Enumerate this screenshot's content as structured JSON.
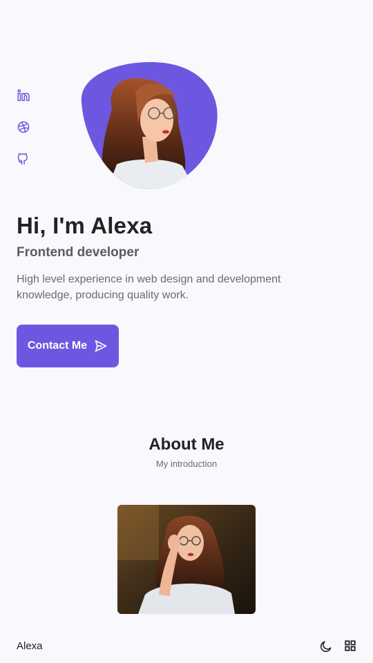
{
  "social": {
    "icons": [
      "linkedin-icon",
      "dribbble-icon",
      "github-icon"
    ]
  },
  "hero": {
    "title": "Hi, I'm Alexa",
    "subtitle": "Frontend developer",
    "description": "High level experience in web design and development knowledge, producing quality work.",
    "contact_label": "Contact Me",
    "contact_icon": "send-icon"
  },
  "about": {
    "title": "About Me",
    "subtitle": "My introduction"
  },
  "nav": {
    "brand": "Alexa",
    "theme_icon": "moon-icon",
    "menu_icon": "grid-icon"
  },
  "colors": {
    "accent": "#6e57e0",
    "background": "#f9f8fc",
    "text": "#222222"
  }
}
